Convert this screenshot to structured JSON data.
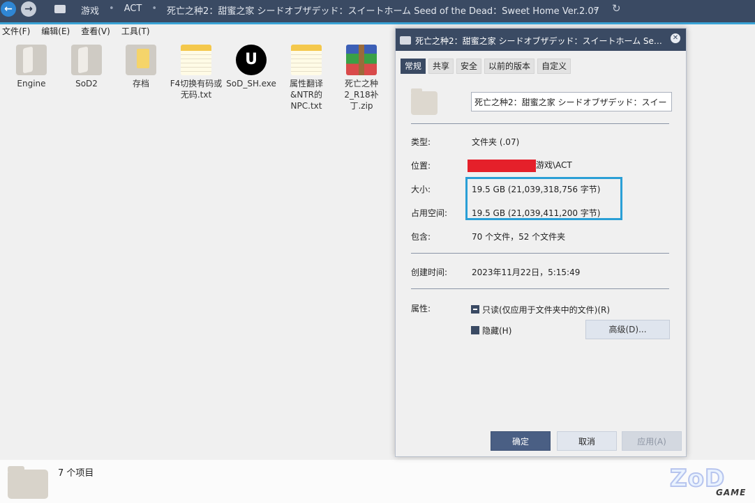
{
  "explorer": {
    "breadcrumb": [
      "游戏",
      "ACT",
      "死亡之种2：甜蜜之家 シードオブザデッド：スイートホーム Seed of the Dead：Sweet Home Ver.2.07"
    ],
    "back_glyph": "←",
    "forward_glyph": "→",
    "dropdown_glyph": "⌄",
    "refresh_glyph": "↻",
    "menu": [
      "文件(F)",
      "编辑(E)",
      "查看(V)",
      "工具(T)"
    ],
    "files": [
      {
        "name": "Engine",
        "icon": "folder-icon"
      },
      {
        "name": "SoD2",
        "icon": "folder-icon"
      },
      {
        "name": "存档",
        "icon": "folder-icon"
      },
      {
        "name": "F4切换有码或无码.txt",
        "icon": "text-file-icon"
      },
      {
        "name": "SoD_SH.exe",
        "icon": "unreal-engine-icon"
      },
      {
        "name": "属性翻译&NTR的NPC.txt",
        "icon": "text-file-icon"
      },
      {
        "name": "死亡之种2_R18补丁.zip",
        "icon": "winrar-archive-icon"
      }
    ],
    "status": "7 个项目",
    "exe_glyph": "U",
    "logo": {
      "main": "ZoD",
      "sub": "GAME"
    }
  },
  "dialog": {
    "title": "死亡之种2：甜蜜之家 シードオブザデッド：スイートホーム See...",
    "close_glyph": "✕",
    "tabs": [
      "常规",
      "共享",
      "安全",
      "以前的版本",
      "自定义"
    ],
    "active_tab": 0,
    "name_value": "死亡之种2：甜蜜之家 シードオブザデッド：スイー",
    "labels": {
      "type": "类型:",
      "location": "位置:",
      "size": "大小:",
      "size_on_disk": "占用空间:",
      "contains": "包含:",
      "created": "创建时间:",
      "attributes": "属性:"
    },
    "values": {
      "type": "文件夹 (.07)",
      "location": "游戏\\ACT",
      "size": "19.5 GB (21,039,318,756 字节)",
      "size_on_disk": "19.5 GB (21,039,411,200 字节)",
      "contains": "70 个文件，52 个文件夹",
      "created": "2023年11月22日，5:15:49"
    },
    "attributes": {
      "readonly": "只读(仅应用于文件夹中的文件)(R)",
      "hidden": "隐藏(H)",
      "advanced": "高级(D)..."
    },
    "buttons": {
      "ok": "确定",
      "cancel": "取消",
      "apply": "应用(A)"
    }
  }
}
